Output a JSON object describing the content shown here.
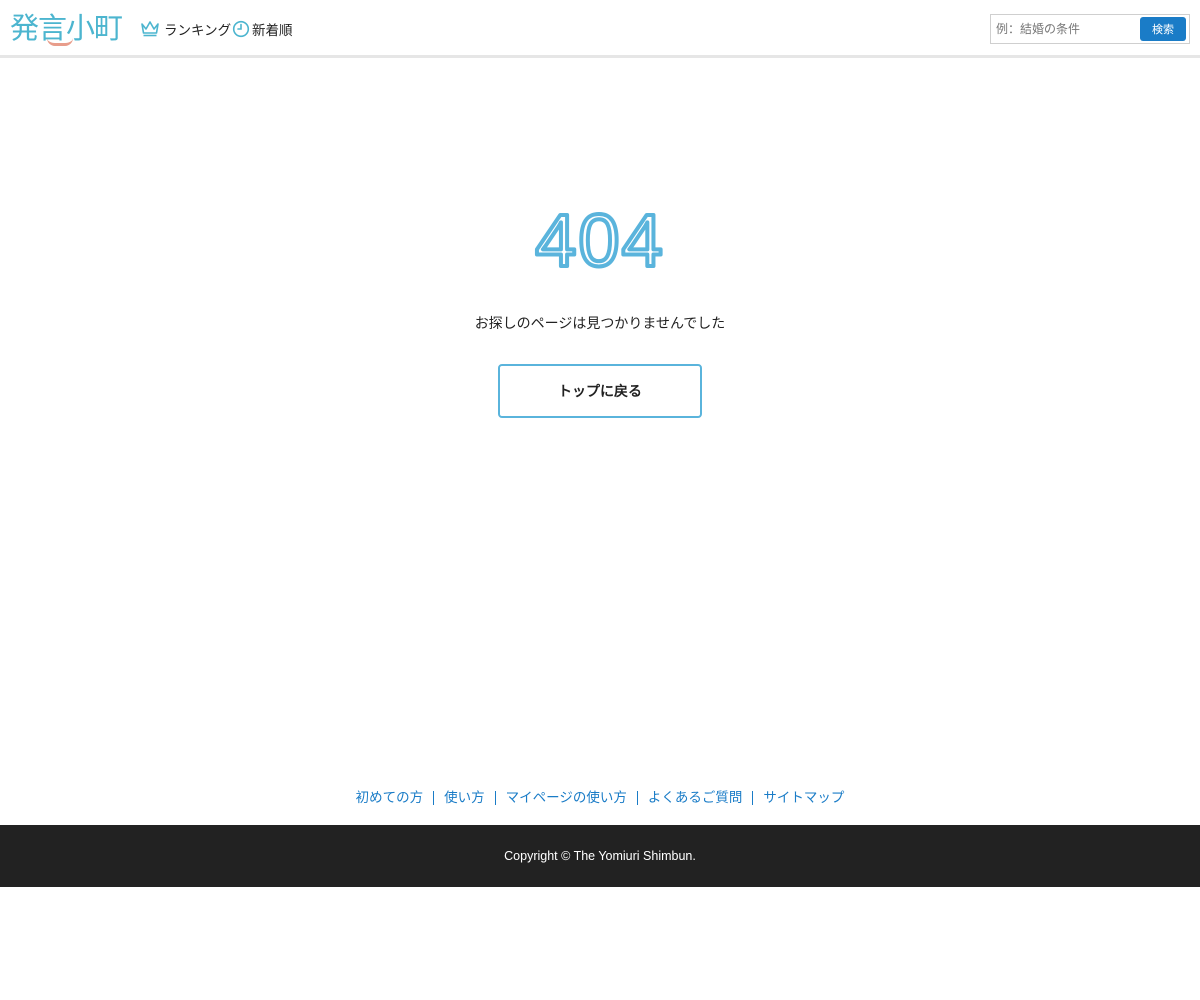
{
  "header": {
    "logo_text": "発言小町",
    "nav_ranking_label": "ランキング",
    "nav_new_label": "新着順",
    "search_placeholder": "例：結婚の条件",
    "search_button_label": "検索"
  },
  "main": {
    "error_code": "404",
    "error_message": "お探しのページは見つかりませんでした",
    "top_button_label": "トップに戻る"
  },
  "footer": {
    "links": [
      "初めての方",
      "使い方",
      "マイページの使い方",
      "よくあるご質問",
      "サイトマップ"
    ],
    "copyright": "Copyright © The Yomiuri Shimbun."
  },
  "colors": {
    "brand": "#4cb5cf",
    "accent_pink": "#e89d8b",
    "link_blue": "#1a7cc7",
    "error_blue": "#5ab4dc",
    "footer_bg": "#222222"
  },
  "icons": {
    "ranking": "crown-icon",
    "new": "clock-icon"
  }
}
